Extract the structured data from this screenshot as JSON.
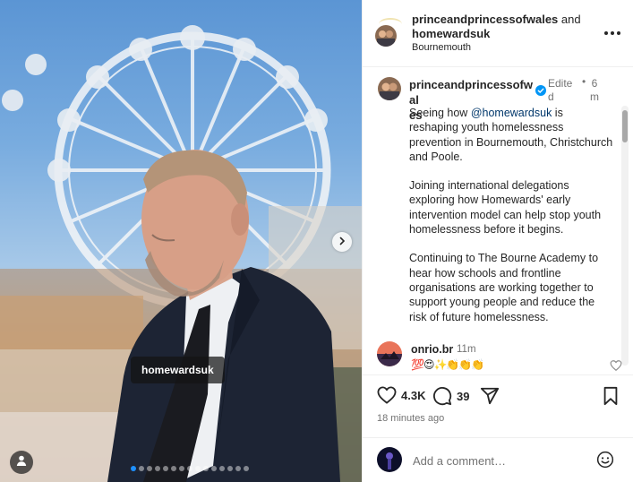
{
  "photo": {
    "tag_label": "homewardsuk",
    "carousel": {
      "total": 15,
      "active_index": 0
    },
    "icons": {
      "next": "chevron-right-icon",
      "tagged": "person-icon"
    }
  },
  "header": {
    "user1": "princeandprincessofwales",
    "joiner": "and",
    "user2": "homewardsuk",
    "location": "Bournemouth"
  },
  "caption": {
    "username_line1": "princeandprincessofwal",
    "username_line2": "es",
    "edited_line1": "Edite",
    "edited_line2": "d",
    "separator": "•",
    "time_line1": "6",
    "time_line2": "m",
    "p1_before": "Seeing how ",
    "p1_mention": "@homewardsuk",
    "p1_after": " is reshaping youth homelessness prevention in Bournemouth, Christchurch and Poole.",
    "p2": "Joining international delegations exploring how Homewards' early intervention model can help stop youth homelessness before it begins.",
    "p3": "Continuing to The Bourne Academy to hear how schools and frontline organisations are working together to support young people and reduce the risk of future homelessness."
  },
  "comment": {
    "username": "onrio.br",
    "time": "11m",
    "emojis": "💯😍✨👏👏👏"
  },
  "actions": {
    "likes": "4.3K",
    "comments": "39",
    "posted_ago": "18 minutes ago"
  },
  "add_comment": {
    "placeholder": "Add a comment…"
  },
  "colors": {
    "mention": "#00376b",
    "verified": "#0095f6",
    "carousel_active": "#1e90ff"
  }
}
